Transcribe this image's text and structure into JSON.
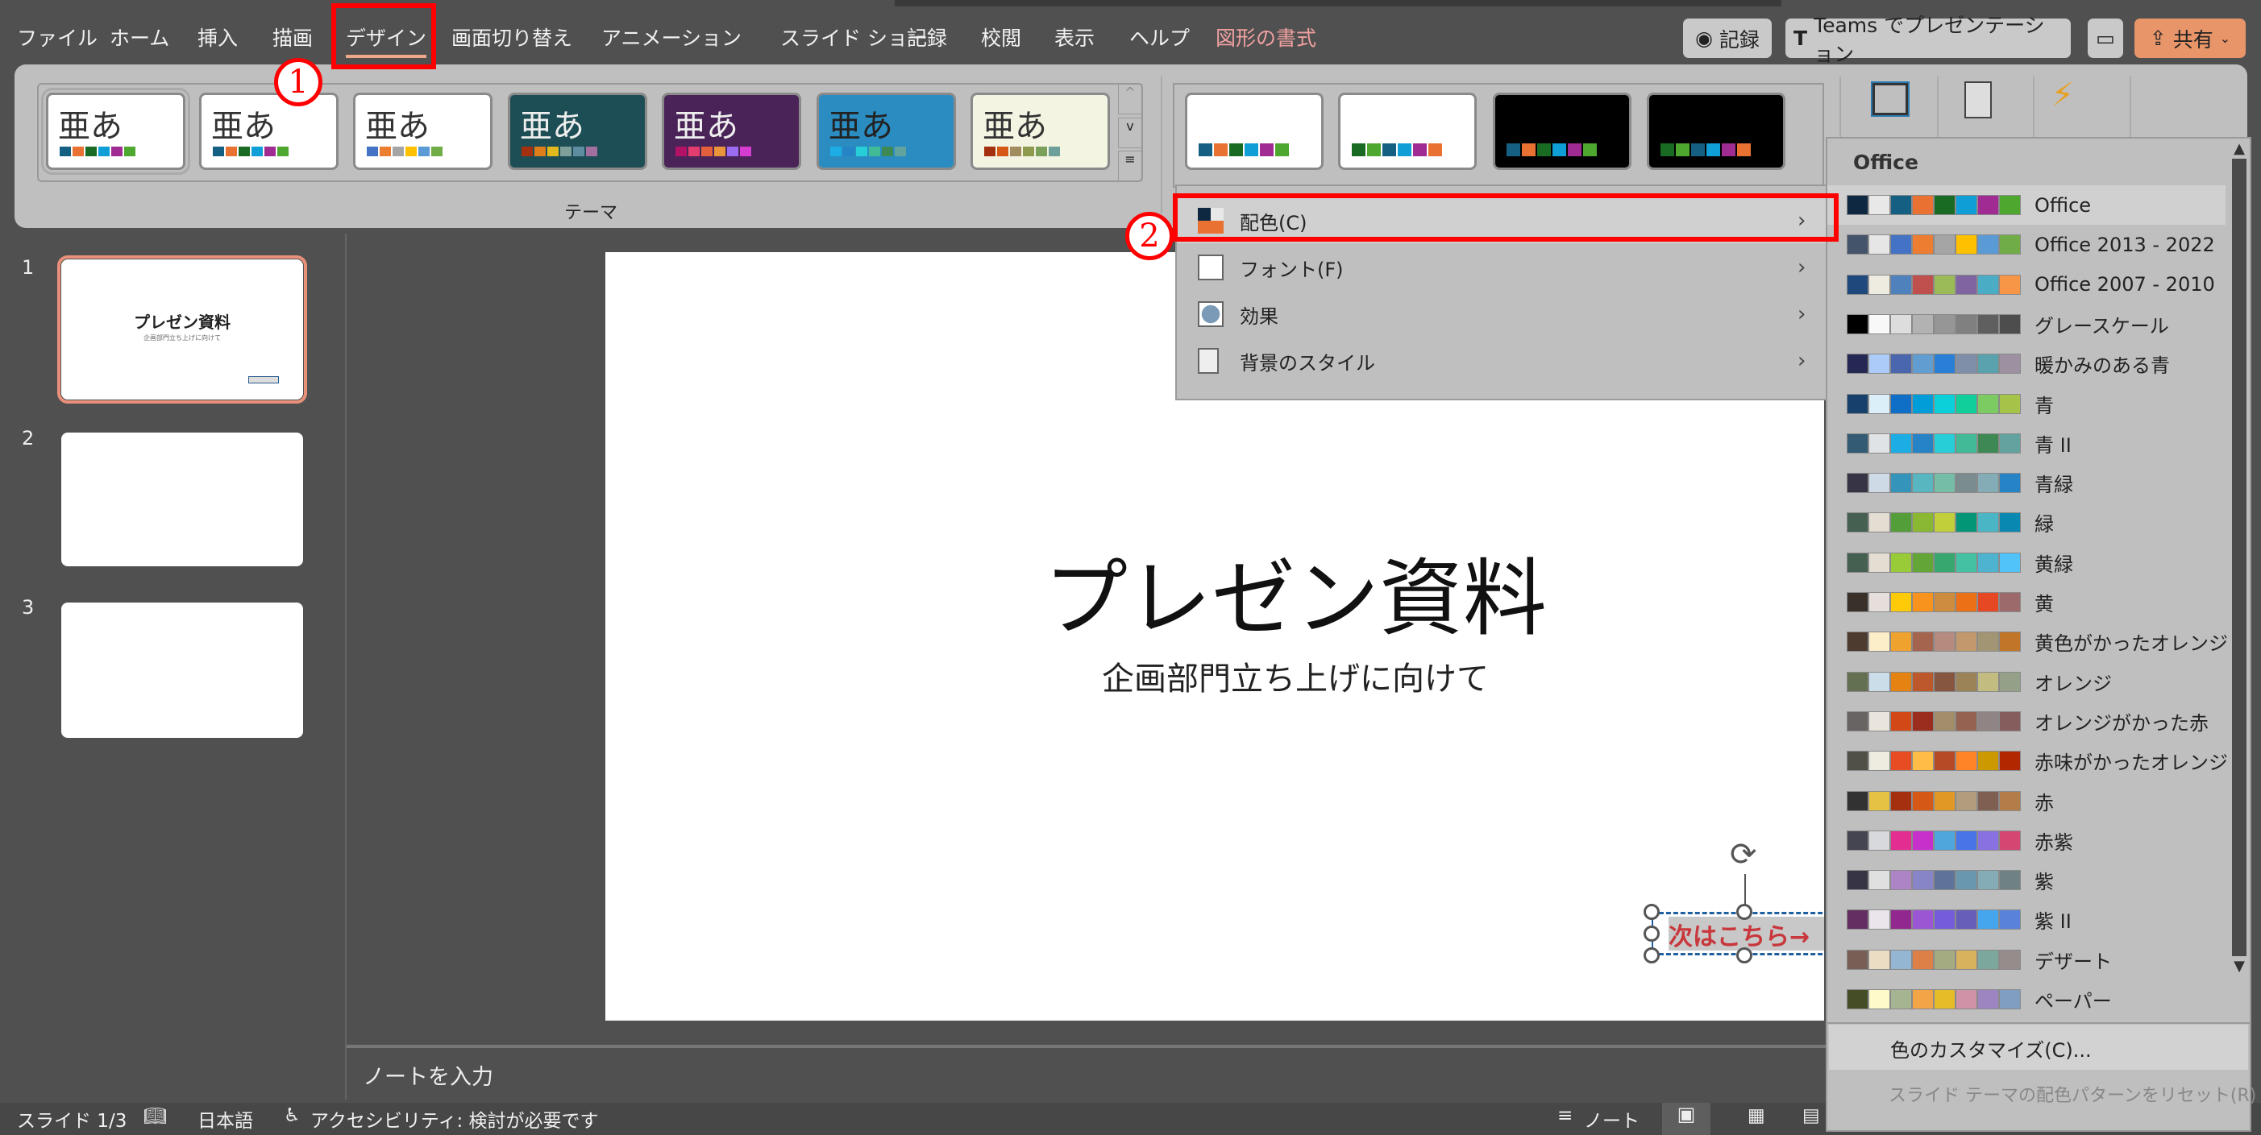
{
  "menubar": {
    "tabs": [
      "ファイル",
      "ホーム",
      "挿入",
      "描画",
      "デザイン",
      "画面切り替え",
      "アニメーション",
      "スライド ショー",
      "記録",
      "校閲",
      "表示",
      "ヘルプ",
      "図形の書式"
    ],
    "active": "デザイン"
  },
  "topright": {
    "record": "記録",
    "teams": "Teams でプレゼンテーション",
    "share": "共有",
    "share_color": "#E8956A"
  },
  "ribbon": {
    "themes_label": "テーマ",
    "theme_glyph": "亜あ",
    "themes": [
      {
        "bg": "#FFFFFF",
        "fg": "#333333",
        "colors": [
          "#156082",
          "#E97132",
          "#196B24",
          "#0F9ED5",
          "#A02B93",
          "#4EA72E"
        ]
      },
      {
        "bg": "#FFFFFF",
        "fg": "#333333",
        "colors": [
          "#156082",
          "#E97132",
          "#196B24",
          "#0F9ED5",
          "#A02B93",
          "#4EA72E"
        ]
      },
      {
        "bg": "#FFFFFF",
        "fg": "#333333",
        "colors": [
          "#4472C4",
          "#ED7D31",
          "#A5A5A5",
          "#FFC000",
          "#5B9BD5",
          "#70AD47"
        ]
      },
      {
        "bg": "#1E4E55",
        "fg": "#EEEEEE",
        "colors": [
          "#A53010",
          "#DE7E18",
          "#E2B91D",
          "#7F9F9A",
          "#5F8CA0",
          "#A36F9E"
        ]
      },
      {
        "bg": "#4A2358",
        "fg": "#EEEEEE",
        "colors": [
          "#B31166",
          "#E33D6F",
          "#E45F3C",
          "#E9943A",
          "#9B6BF2",
          "#D53DD0"
        ]
      },
      {
        "bg": "#2A8CC0",
        "fg": "#222222",
        "colors": [
          "#1CADE4",
          "#2683C6",
          "#27CED7",
          "#42BA97",
          "#3E8853",
          "#62A39F"
        ]
      },
      {
        "bg": "#F4F4E2",
        "fg": "#333333",
        "colors": [
          "#A5300F",
          "#D55816",
          "#A08C5F",
          "#8E9A4E",
          "#7BA05B",
          "#6E9F9A"
        ]
      }
    ],
    "variants": [
      {
        "bg": "#FFFFFF",
        "colors": [
          "#156082",
          "#E97132",
          "#196B24",
          "#0F9ED5",
          "#A02B93",
          "#4EA72E"
        ]
      },
      {
        "bg": "#FFFFFF",
        "colors": [
          "#196B24",
          "#4EA72E",
          "#156082",
          "#0F9ED5",
          "#A02B93",
          "#E97132"
        ]
      },
      {
        "bg": "#000000",
        "colors": [
          "#156082",
          "#E97132",
          "#196B24",
          "#0F9ED5",
          "#A02B93",
          "#4EA72E"
        ]
      },
      {
        "bg": "#000000",
        "colors": [
          "#196B24",
          "#4EA72E",
          "#156082",
          "#0F9ED5",
          "#A02B93",
          "#E97132"
        ]
      }
    ]
  },
  "variant_menu": {
    "items": [
      {
        "label": "配色(C)",
        "icon": "color-scheme-icon"
      },
      {
        "label": "フォント(F)",
        "icon": "font-icon"
      },
      {
        "label": "効果",
        "icon": "effects-icon"
      },
      {
        "label": "背景のスタイル",
        "icon": "background-style-icon"
      }
    ]
  },
  "colors_menu": {
    "header": "Office",
    "customize": "色のカスタマイズ(C)...",
    "reset": "スライド テーマの配色パターンをリセット(R)",
    "schemes": [
      {
        "name": "Office",
        "c": [
          "#0E2841",
          "#E8E8E8",
          "#156082",
          "#E97132",
          "#196B24",
          "#0F9ED5",
          "#A02B93",
          "#4EA72E"
        ]
      },
      {
        "name": "Office 2013 - 2022",
        "c": [
          "#44546A",
          "#E7E6E6",
          "#4472C4",
          "#ED7D31",
          "#A5A5A5",
          "#FFC000",
          "#5B9BD5",
          "#70AD47"
        ]
      },
      {
        "name": "Office 2007 - 2010",
        "c": [
          "#1F497D",
          "#EEECE1",
          "#4F81BD",
          "#C0504D",
          "#9BBB59",
          "#8064A2",
          "#4BACC6",
          "#F79646"
        ]
      },
      {
        "name": "グレースケール",
        "c": [
          "#000000",
          "#F8F8F8",
          "#DDDDDD",
          "#B2B2B2",
          "#969696",
          "#808080",
          "#5F5F5F",
          "#4D4D4D"
        ]
      },
      {
        "name": "暖かみのある青",
        "c": [
          "#242852",
          "#ACCBF9",
          "#4A66AC",
          "#629DD1",
          "#297FD5",
          "#7F8FA9",
          "#5AA2AE",
          "#9D90A0"
        ]
      },
      {
        "name": "青",
        "c": [
          "#17406D",
          "#DBEFF9",
          "#0F6FC6",
          "#009DD9",
          "#0BD0D9",
          "#10CF9B",
          "#7CCA62",
          "#A5C249"
        ]
      },
      {
        "name": "青 II",
        "c": [
          "#335B74",
          "#DFE3E5",
          "#1CADE4",
          "#2683C6",
          "#27CED7",
          "#42BA97",
          "#3E8853",
          "#62A39F"
        ]
      },
      {
        "name": "青緑",
        "c": [
          "#373545",
          "#CEDBE6",
          "#3494BA",
          "#58B6C0",
          "#75BDA7",
          "#7A8C8E",
          "#84ACB6",
          "#2683C6"
        ]
      },
      {
        "name": "緑",
        "c": [
          "#455F51",
          "#E3DED1",
          "#549E39",
          "#8AB833",
          "#C0CF3A",
          "#029676",
          "#4AB5C4",
          "#0989B1"
        ]
      },
      {
        "name": "黄緑",
        "c": [
          "#455F51",
          "#E3DED1",
          "#99CB38",
          "#63A537",
          "#37A76F",
          "#44C1A3",
          "#4EB3CF",
          "#51C3F9"
        ]
      },
      {
        "name": "黄",
        "c": [
          "#39302A",
          "#E5DEDB",
          "#FFCA08",
          "#F8931D",
          "#CE8D3E",
          "#EC7016",
          "#E64823",
          "#9C6A6A"
        ]
      },
      {
        "name": "黄色がかったオレンジ",
        "c": [
          "#4E3B30",
          "#FBEEC9",
          "#F0A22E",
          "#A5644E",
          "#B58B80",
          "#C3986D",
          "#A19574",
          "#C17529"
        ]
      },
      {
        "name": "オレンジ",
        "c": [
          "#637052",
          "#CCDDEA",
          "#E48312",
          "#BD582C",
          "#865640",
          "#9B8357",
          "#C2BC80",
          "#94A088"
        ]
      },
      {
        "name": "オレンジがかった赤",
        "c": [
          "#696464",
          "#E9E5DC",
          "#D34817",
          "#9B2D1F",
          "#A28E6A",
          "#956251",
          "#918485",
          "#855D5D"
        ]
      },
      {
        "name": "赤味がかったオレンジ",
        "c": [
          "#505046",
          "#EEECE1",
          "#E84C22",
          "#FFBD47",
          "#B64926",
          "#FF8427",
          "#CC9900",
          "#B22600"
        ]
      },
      {
        "name": "赤",
        "c": [
          "#323232",
          "#E5C243",
          "#A5300F",
          "#D55816",
          "#E19825",
          "#B19C7D",
          "#7F5F52",
          "#B27D49"
        ]
      },
      {
        "name": "赤紫",
        "c": [
          "#454551",
          "#D8D9DC",
          "#E32D91",
          "#C830CC",
          "#4EA6DC",
          "#4775E7",
          "#8971E1",
          "#D54773"
        ]
      },
      {
        "name": "紫",
        "c": [
          "#373545",
          "#E0E0E0",
          "#AD84C6",
          "#8784C7",
          "#5D739A",
          "#6997AF",
          "#84ACB6",
          "#6F8183"
        ]
      },
      {
        "name": "紫 II",
        "c": [
          "#632E62",
          "#EAE5EB",
          "#92278F",
          "#9B57D3",
          "#755DD9",
          "#665EB8",
          "#45A5ED",
          "#5982DB"
        ]
      },
      {
        "name": "デザート",
        "c": [
          "#775F55",
          "#EBDDC3",
          "#94B6D2",
          "#DD8047",
          "#A5AB81",
          "#D8B25C",
          "#7BA79D",
          "#968C8C"
        ]
      },
      {
        "name": "ペーパー",
        "c": [
          "#444D26",
          "#FEFAC9",
          "#A5B592",
          "#F3A447",
          "#E7BC29",
          "#D092A7",
          "#9C85C0",
          "#809EC2"
        ]
      }
    ]
  },
  "slides": {
    "numbers": [
      "1",
      "2",
      "3"
    ],
    "title": "プレゼン資料",
    "subtitle": "企画部門立ち上げに向けて",
    "textbox": "次はこちら→",
    "textbox_color": "#C8373B"
  },
  "notes": {
    "placeholder": "ノートを入力"
  },
  "statusbar": {
    "slide": "スライド 1/3",
    "language": "日本語",
    "accessibility": "アクセシビリティ: 検討が必要です",
    "notes": "ノート"
  },
  "annotations": {
    "step1": "1",
    "step2": "2"
  }
}
